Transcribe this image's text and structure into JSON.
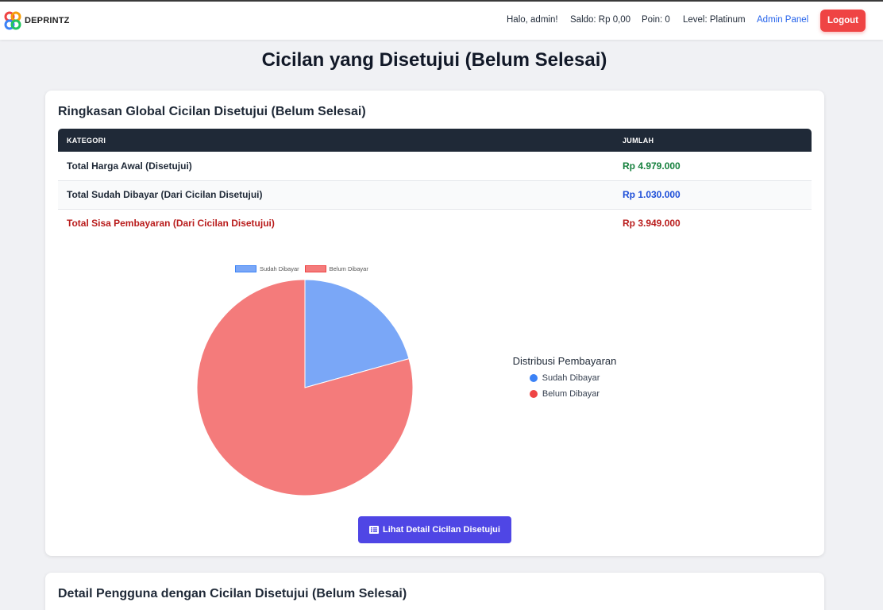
{
  "navbar": {
    "brand": "DEPRINTZ",
    "greeting": "Halo, admin!",
    "saldo": "Saldo: Rp 0,00",
    "poin": "Poin: 0",
    "level": "Level: Platinum",
    "admin_panel": "Admin Panel",
    "logout": "Logout"
  },
  "page": {
    "title": "Cicilan yang Disetujui (Belum Selesai)"
  },
  "summary": {
    "title": "Ringkasan Global Cicilan Disetujui (Belum Selesai)",
    "headers": [
      "KATEGORI",
      "JUMLAH"
    ],
    "rows": [
      {
        "category": "Total Harga Awal (Disetujui)",
        "amount": "Rp 4.979.000",
        "category_color": "#1f2937",
        "amount_color": "#15803d"
      },
      {
        "category": "Total Sudah Dibayar (Dari Cicilan Disetujui)",
        "amount": "Rp 1.030.000",
        "category_color": "#1f2937",
        "amount_color": "#1d4ed8"
      },
      {
        "category": "Total Sisa Pembayaran (Dari Cicilan Disetujui)",
        "amount": "Rp 3.949.000",
        "category_color": "#b91c1c",
        "amount_color": "#b91c1c"
      }
    ]
  },
  "chart_data": {
    "type": "pie",
    "title": "",
    "categories": [
      "Sudah Dibayar",
      "Belum Dibayar"
    ],
    "values": [
      1030000,
      3949000
    ],
    "colors": [
      "#7aa7f7",
      "#f47b7b"
    ],
    "legend": "top"
  },
  "distribution": {
    "title": "Distribusi Pembayaran",
    "items": [
      {
        "label": "Sudah Dibayar",
        "color": "#3b82f6"
      },
      {
        "label": "Belum Dibayar",
        "color": "#ef4444"
      }
    ]
  },
  "detail_button": {
    "label": "Lihat Detail Cicilan Disetujui",
    "icon": "list-icon",
    "color": "#4f46e5"
  },
  "users_section": {
    "title": "Detail Pengguna dengan Cicilan Disetujui (Belum Selesai)"
  }
}
